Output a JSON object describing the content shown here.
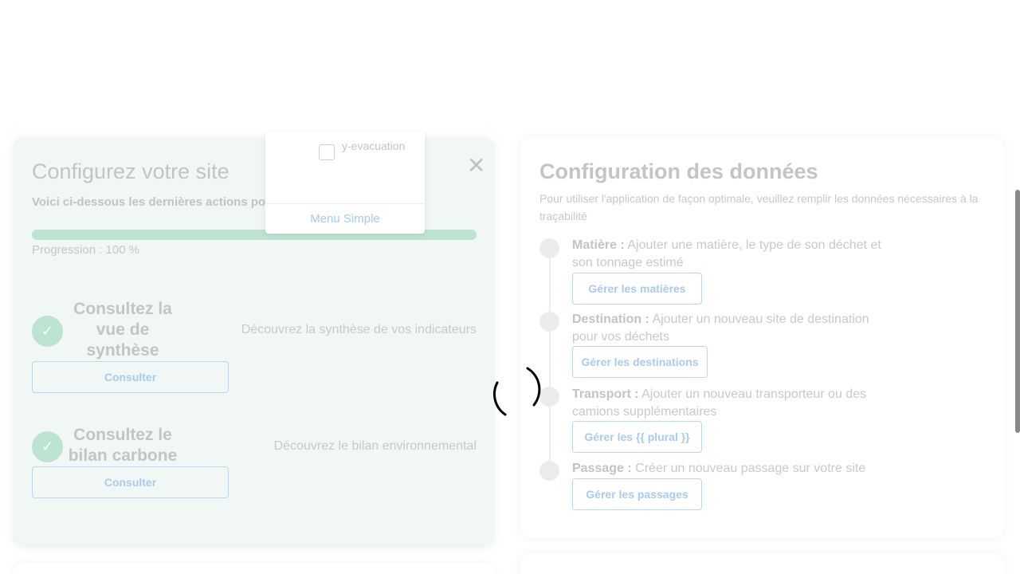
{
  "setup_card": {
    "title": "Configurez votre site",
    "description": "Voici ci-dessous les dernières actions po                                     on de votre site",
    "progress_label": "Progression : 100 %",
    "progress_value": 1.0,
    "tasks": [
      {
        "title": "Consultez la vue de synthèse",
        "description": "Découvrez la synthèse de vos indicateurs",
        "button": "Consulter"
      },
      {
        "title": "Consultez le bilan carbone",
        "description": "Découvrez le bilan environnemental",
        "button": "Consulter"
      }
    ]
  },
  "data_card": {
    "title": "Configuration des données",
    "description": "Pour utiliser l'application de façon optimale, veuillez remplir les données nécessaires à la traçabilité",
    "steps": [
      {
        "label": "Matière :",
        "text": " Ajouter une matière, le type de son déchet et son tonnage estimé",
        "button": "Gérer les matières"
      },
      {
        "label": "Destination :",
        "text": " Ajouter un nouveau site de destination pour vos déchets",
        "button": "Gérer les destinations"
      },
      {
        "label": "Transport :",
        "text": " Ajouter un nouveau transporteur ou des camions supplémentaires",
        "button": "Gérer les {{ plural }}"
      },
      {
        "label": "Passage :",
        "text": " Créer un nouveau passage sur votre site",
        "button": "Gérer les passages"
      }
    ]
  },
  "dropdown": {
    "checkbox_label": "y-evacuation",
    "menu_link": "Menu Simple"
  },
  "colors": {
    "accent_green": "#bde3d2",
    "accent_blue": "#a9cbee"
  },
  "icons": {
    "close": "close-icon",
    "check": "check-icon",
    "spinner": "loading-spinner-icon"
  }
}
